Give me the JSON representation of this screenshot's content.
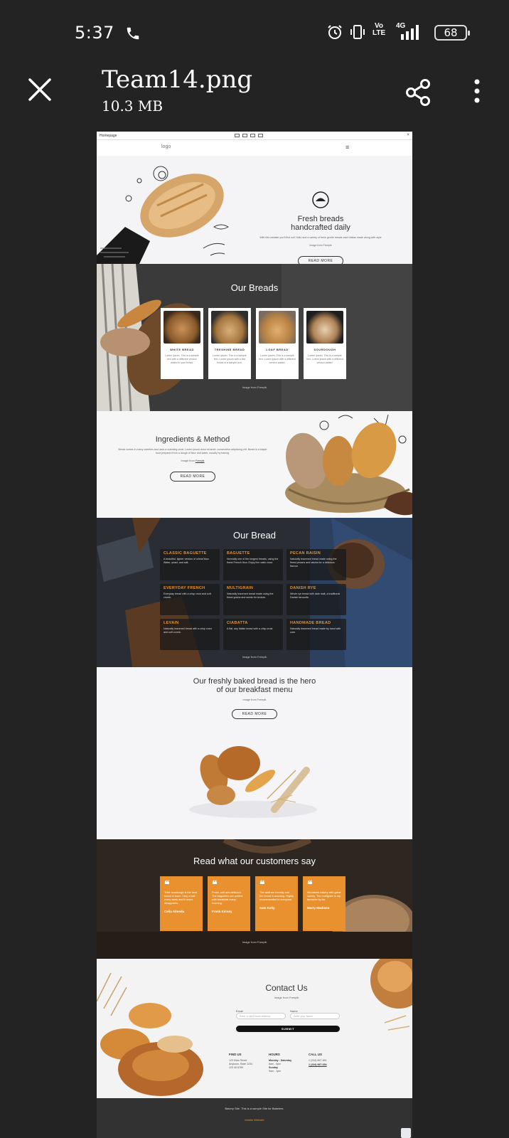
{
  "status": {
    "time": "5:37",
    "network": "4G",
    "volte": "Vo LTE",
    "battery": "68"
  },
  "viewer": {
    "file_name": "Team14.png",
    "file_size": "10.3 MB"
  },
  "mockup": {
    "browser_title": "Homepage",
    "nav": {
      "logo": "logo",
      "menu_icon": "≡"
    },
    "hero": {
      "title_line1": "Fresh breads",
      "title_line2": "handcrafted daily",
      "body": "With this website you'll find out! Hello and a variety of fresh gentle breads each Italian made along with style",
      "credit": "Image from Freepik",
      "button": "READ MORE"
    },
    "our_breads": {
      "title": "Our Breads",
      "cards": [
        {
          "name": "WHITE BREAD",
          "desc": "Lorem ipsum. This is a sample text with a different version added to your bread.",
          "more": "more"
        },
        {
          "name": "TRESHINE BREAD",
          "desc": "Lorem ipsum. This is a sample text. Lorem ipsum with a few bread in a sample text.",
          "more": "more"
        },
        {
          "name": "LOAF BREAD",
          "desc": "Lorem ipsum. This is a sample text. Lorem ipsum with a different version added.",
          "more": "more"
        },
        {
          "name": "SOURDOUGH",
          "desc": "Lorem ipsum. This is a sample text. Lorem ipsum with a different version added.",
          "more": "more"
        }
      ],
      "credit": "Image from Freepik"
    },
    "ingredients": {
      "title": "Ingredients & Method",
      "body": "Bread comes in many varieties and uses a crackling crust. Lorem ipsum dolor sit amet, consectetur adipiscing elit. Bread is a staple food prepared from a dough of flour and water, usually by baking.",
      "credit_prefix": "Image from ",
      "credit_link": "Freepik",
      "button": "READ MORE"
    },
    "our_bread": {
      "title": "Our Bread",
      "items": [
        {
          "name": "CLASSIC BAGUETTE",
          "desc": "A beautiful, lighter version of wheat flour. Water, yeast, and salt."
        },
        {
          "name": "BAGUETTE",
          "desc": "Normally one of the longest breads, using the finest French flour. Enjoy the rustic crust."
        },
        {
          "name": "PECAN RAISIN",
          "desc": "Naturally leavened bread made using the finest pecans and raisins for a delicious flavour."
        },
        {
          "name": "EVERYDAY FRENCH",
          "desc": "Everyday bread with a crisp crust and soft crumb."
        },
        {
          "name": "MULTIGRAIN",
          "desc": "Naturally leavened bread made using the finest grains and seeds for texture."
        },
        {
          "name": "DANISH RYE",
          "desc": "Whole rye bread with dark malt, a traditional Danish favourite."
        },
        {
          "name": "LEVAIN",
          "desc": "Naturally leavened bread with a crisp crust and soft crumb."
        },
        {
          "name": "CIABATTA",
          "desc": "A flat, airy Italian bread with a crisp crust."
        },
        {
          "name": "HANDMADE BREAD",
          "desc": "Naturally leavened bread made by hand with care."
        }
      ],
      "credit": "Image from Freepik"
    },
    "breakfast": {
      "title_line1": "Our freshly baked bread is the hero",
      "title_line2": "of our breakfast menu",
      "credit": "Image from Freepik",
      "button": "READ MORE"
    },
    "testimonials": {
      "title": "Read what our customers say",
      "cards": [
        {
          "text": "Their sourdough is the best bread in town. I buy a loaf every week and it never disappoints.",
          "name": "Celia Almeda"
        },
        {
          "text": "Fresh, soft and delicious. The baguettes are perfect with breakfast every morning.",
          "name": "Frank Kinney"
        },
        {
          "text": "The staff are friendly and the bread is amazing. Highly recommended to everyone.",
          "name": "Sam Kelly"
        },
        {
          "text": "Wonderful bakery with great variety. The multigrain is my favourite by far.",
          "name": "Marty Madison"
        }
      ],
      "credit": "Image from Freepik"
    },
    "contact": {
      "title": "Contact Us",
      "credit": "Image from Freepik",
      "email_label": "Email",
      "email_placeholder": "Enter a valid email address",
      "name_label": "Name",
      "name_placeholder": "Enter your Name",
      "submit": "SUBMIT",
      "cols": [
        {
          "head": "FIND US",
          "lines": [
            "123 Main Street",
            "Anytown, State 1234",
            "123 45 6789"
          ]
        },
        {
          "head": "HOURS",
          "lines": [
            "Monday - Saturday",
            "8am - 5pm",
            "Sunday",
            "9am - 1pm"
          ]
        },
        {
          "head": "CALL US",
          "lines": [
            "1 (234) 567-891",
            "1 (234) 987-654"
          ]
        }
      ]
    },
    "footer": {
      "line1": "Bakery Site. This is a sample Site for Bakeries.",
      "line2": "Mobile Website"
    }
  }
}
